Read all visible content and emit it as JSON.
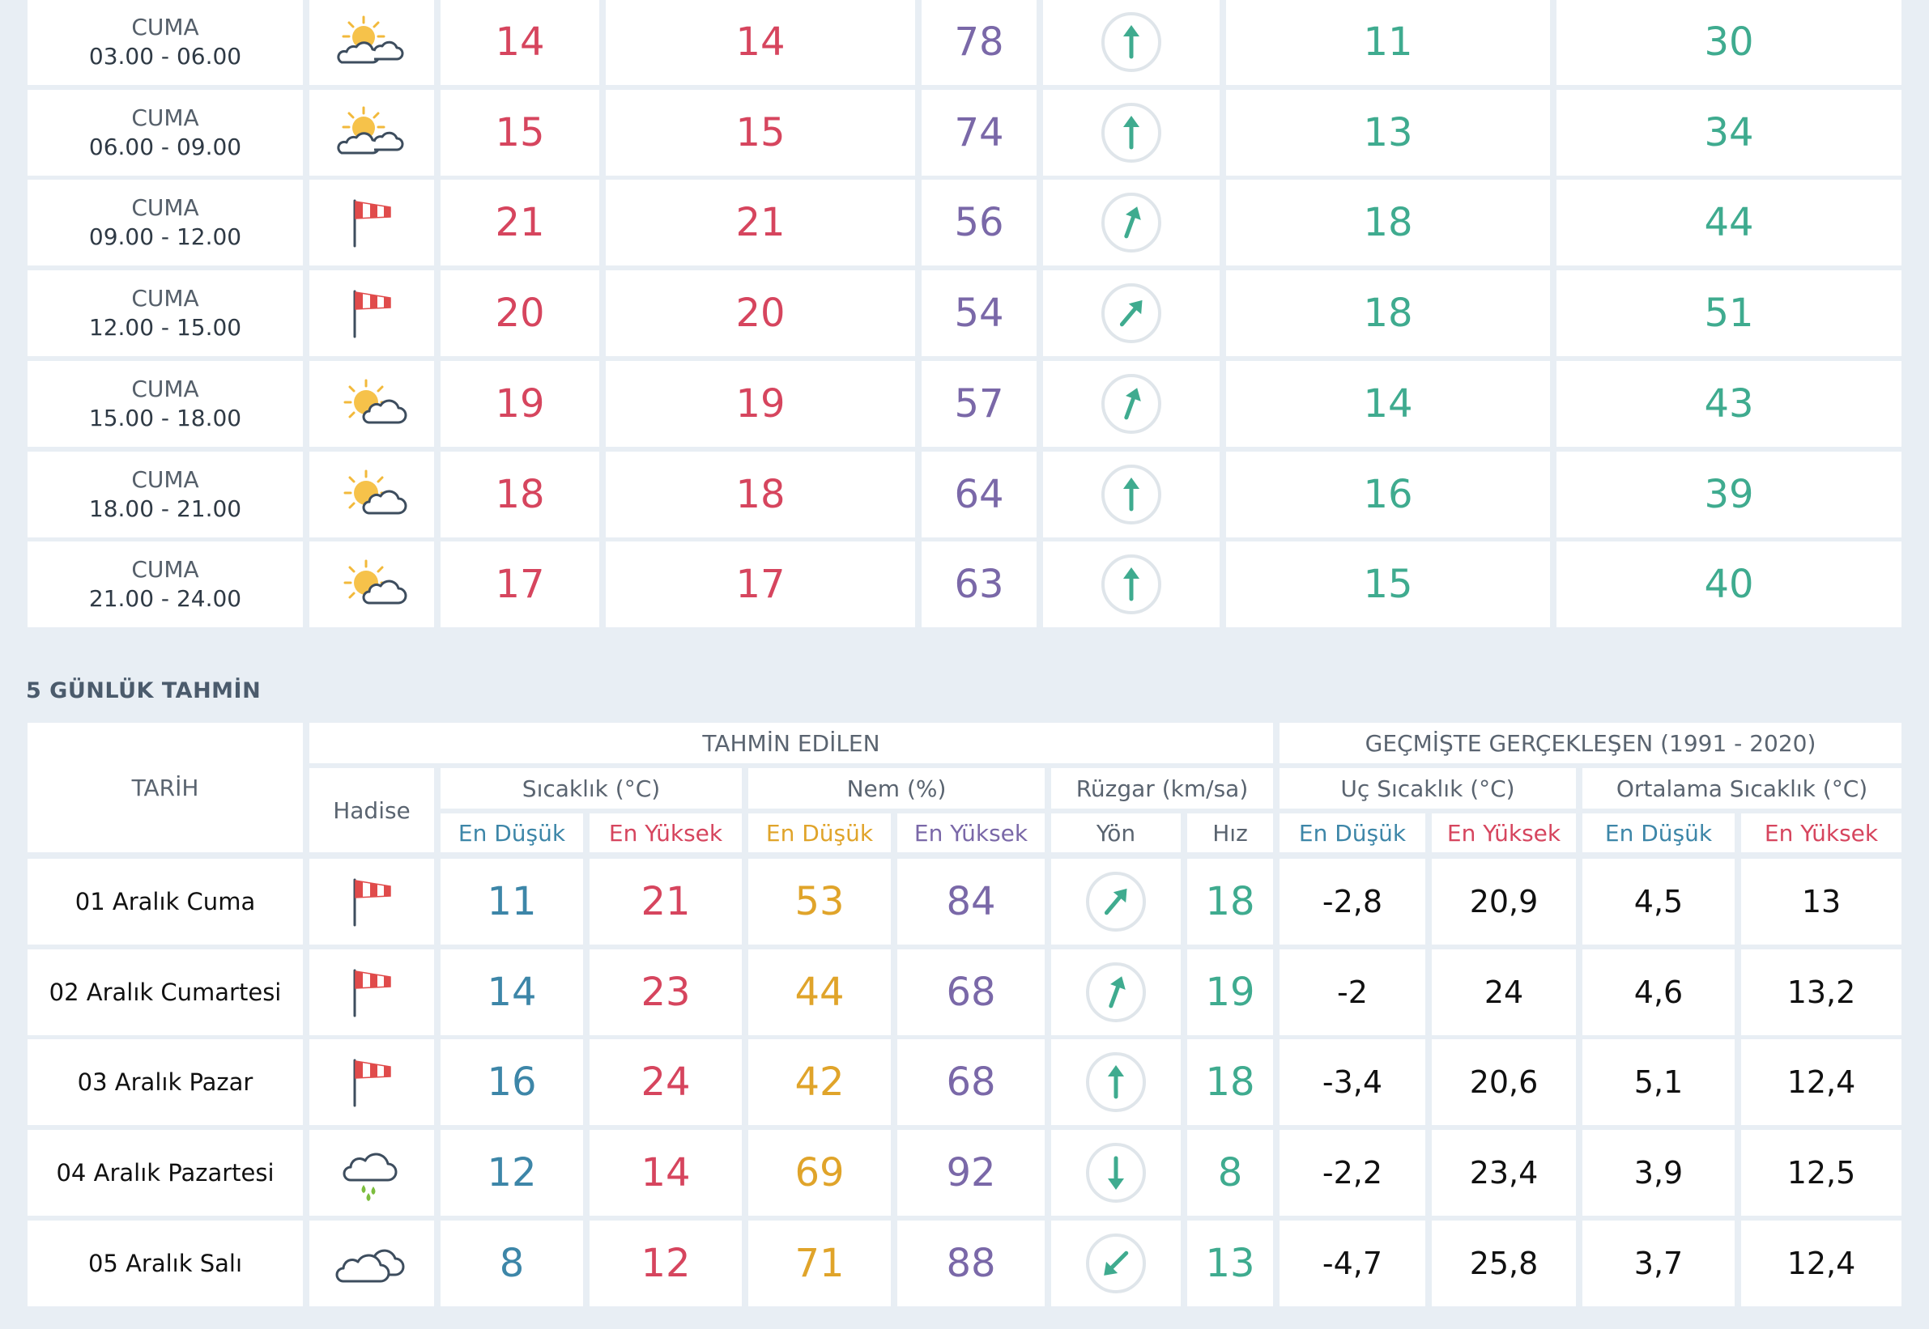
{
  "hourly": {
    "rows": [
      {
        "day": "CUMA",
        "time": "03.00 - 06.00",
        "icon": "partly-cloudy-icon",
        "temp": "14",
        "feels": "14",
        "humidity": "78",
        "wind_dir": "N",
        "wind_speed": "11",
        "gust": "30"
      },
      {
        "day": "CUMA",
        "time": "06.00 - 09.00",
        "icon": "partly-cloudy-icon",
        "temp": "15",
        "feels": "15",
        "humidity": "74",
        "wind_dir": "N",
        "wind_speed": "13",
        "gust": "34"
      },
      {
        "day": "CUMA",
        "time": "09.00 - 12.00",
        "icon": "windsock-icon",
        "temp": "21",
        "feels": "21",
        "humidity": "56",
        "wind_dir": "NNE",
        "wind_speed": "18",
        "gust": "44"
      },
      {
        "day": "CUMA",
        "time": "12.00 - 15.00",
        "icon": "windsock-icon",
        "temp": "20",
        "feels": "20",
        "humidity": "54",
        "wind_dir": "NE",
        "wind_speed": "18",
        "gust": "51"
      },
      {
        "day": "CUMA",
        "time": "15.00 - 18.00",
        "icon": "sun-cloud-icon",
        "temp": "19",
        "feels": "19",
        "humidity": "57",
        "wind_dir": "NNE",
        "wind_speed": "14",
        "gust": "43"
      },
      {
        "day": "CUMA",
        "time": "18.00 - 21.00",
        "icon": "sun-cloud-icon",
        "temp": "18",
        "feels": "18",
        "humidity": "64",
        "wind_dir": "N",
        "wind_speed": "16",
        "gust": "39"
      },
      {
        "day": "CUMA",
        "time": "21.00 - 24.00",
        "icon": "sun-cloud-icon",
        "temp": "17",
        "feels": "17",
        "humidity": "63",
        "wind_dir": "N",
        "wind_speed": "15",
        "gust": "40"
      }
    ]
  },
  "daily": {
    "section_title": "5 GÜNLÜK TAHMİN",
    "headers": {
      "tarih": "TARİH",
      "tahmin": "TAHMİN EDİLEN",
      "gecmis": "GEÇMİŞTE GERÇEKLEŞEN (1991 - 2020)",
      "hadise": "Hadise",
      "sicaklik": "Sıcaklık (°C)",
      "nem": "Nem (%)",
      "ruzgar": "Rüzgar (km/sa)",
      "uc": "Uç Sıcaklık (°C)",
      "ortalama": "Ortalama Sıcaklık (°C)",
      "en_dusuk": "En Düşük",
      "en_yuksek": "En Yüksek",
      "yon": "Yön",
      "hiz": "Hız"
    },
    "rows": [
      {
        "date": "01 Aralık Cuma",
        "icon": "windsock-icon",
        "t_min": "11",
        "t_max": "21",
        "h_min": "53",
        "h_max": "84",
        "wind_dir": "NE",
        "wind_speed": "18",
        "uc_min": "-2,8",
        "uc_max": "20,9",
        "ort_min": "4,5",
        "ort_max": "13"
      },
      {
        "date": "02 Aralık Cumartesi",
        "icon": "windsock-icon",
        "t_min": "14",
        "t_max": "23",
        "h_min": "44",
        "h_max": "68",
        "wind_dir": "NNE",
        "wind_speed": "19",
        "uc_min": "-2",
        "uc_max": "24",
        "ort_min": "4,6",
        "ort_max": "13,2"
      },
      {
        "date": "03 Aralık Pazar",
        "icon": "windsock-icon",
        "t_min": "16",
        "t_max": "24",
        "h_min": "42",
        "h_max": "68",
        "wind_dir": "N",
        "wind_speed": "18",
        "uc_min": "-3,4",
        "uc_max": "20,6",
        "ort_min": "5,1",
        "ort_max": "12,4"
      },
      {
        "date": "04 Aralık Pazartesi",
        "icon": "rain-cloud-icon",
        "t_min": "12",
        "t_max": "14",
        "h_min": "69",
        "h_max": "92",
        "wind_dir": "S",
        "wind_speed": "8",
        "uc_min": "-2,2",
        "uc_max": "23,4",
        "ort_min": "3,9",
        "ort_max": "12,5"
      },
      {
        "date": "05 Aralık Salı",
        "icon": "cloud-icon",
        "t_min": "8",
        "t_max": "12",
        "h_min": "71",
        "h_max": "88",
        "wind_dir": "SW",
        "wind_speed": "13",
        "uc_min": "-4,7",
        "uc_max": "25,8",
        "ort_min": "3,7",
        "ort_max": "12,4"
      }
    ]
  }
}
